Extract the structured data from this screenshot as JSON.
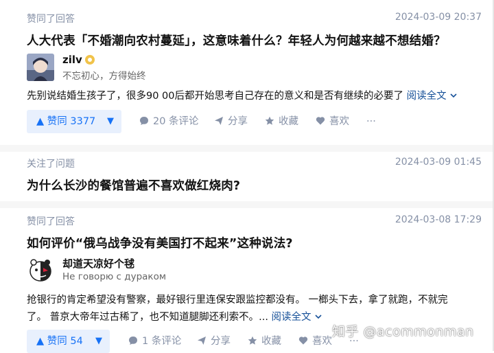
{
  "feed": [
    {
      "action": "赞同了回答",
      "time": "2024-03-09 20:37",
      "title": "人大代表「不婚潮向农村蔓延」，这意味着什么？年轻人为何越来越不想结婚？",
      "author": {
        "name": "zilv",
        "bio": "不忘初心，方得始终"
      },
      "excerpt": "先别说结婚生孩子了，很多90 00后都开始思考自己存在的意义和是否有继续的必要了",
      "read_more": "阅读全文",
      "vote_label": "▲ 赞同 3377",
      "comments": "20 条评论",
      "share": "分享",
      "favorite": "收藏",
      "like": "喜欢",
      "more": "···"
    },
    {
      "action": "关注了问题",
      "time": "2024-03-09 01:45",
      "title": "为什么长沙的餐馆普遍不喜欢做红烧肉?"
    },
    {
      "action": "赞同了回答",
      "time": "2024-03-08 17:29",
      "title": "如何评价“俄乌战争没有美国打不起来”这种说法?",
      "author": {
        "name": "却道天凉好个毬",
        "bio": "Не говорю с дураком"
      },
      "excerpt_line1": "抢银行的肯定希望没有警察，最好银行里连保安跟监控都没有。 一榔头下去，拿了就跑，不就完",
      "excerpt_line2": "了。 普京大帝年过古稀了，也不知道腿脚还利索不。...",
      "read_more": "阅读全文",
      "vote_label": "▲ 赞同 54",
      "comments": "1 条评论",
      "share": "分享",
      "favorite": "收藏",
      "like": "喜欢",
      "more": "···"
    }
  ],
  "vote_down": "▼",
  "watermark": "知乎 @acommonman",
  "icons": {
    "comment": "comment-icon",
    "share": "share-icon",
    "favorite": "star-icon",
    "like": "heart-icon",
    "read_more": "chevron-down-icon"
  },
  "colors": {
    "accent": "#1772f6",
    "meta": "#8590a6",
    "link": "#175199",
    "vote_bg": "#e8f0fd"
  }
}
